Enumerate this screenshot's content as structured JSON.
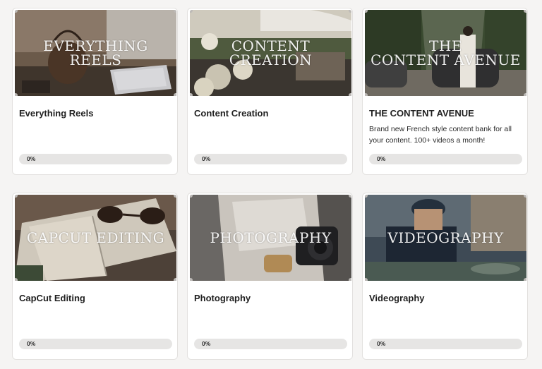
{
  "courses": [
    {
      "thumb_text": "EVERYTHING REELS",
      "title": "Everything Reels",
      "description": "",
      "progress": "0%",
      "progress_value": 0
    },
    {
      "thumb_text": "CONTENT CREATION",
      "title": "Content Creation",
      "description": "",
      "progress": "0%",
      "progress_value": 0
    },
    {
      "thumb_text": "THE\nCONTENT AVENUE",
      "title": "THE CONTENT AVENUE",
      "description": "Brand new French style content bank for all your content. 100+ videos a month!",
      "progress": "0%",
      "progress_value": 0
    },
    {
      "thumb_text": "CAPCUT EDITING",
      "title": "CapCut Editing",
      "description": "",
      "progress": "0%",
      "progress_value": 0
    },
    {
      "thumb_text": "PHOTOGRAPHY",
      "title": "Photography",
      "description": "",
      "progress": "0%",
      "progress_value": 0
    },
    {
      "thumb_text": "VIDEOGRAPHY",
      "title": "Videography",
      "description": "",
      "progress": "0%",
      "progress_value": 0
    }
  ],
  "colors": {
    "page_background": "#f5f4f3",
    "card_background": "#ffffff",
    "progress_track": "#e6e5e4",
    "title_text": "#1f1f1f"
  }
}
